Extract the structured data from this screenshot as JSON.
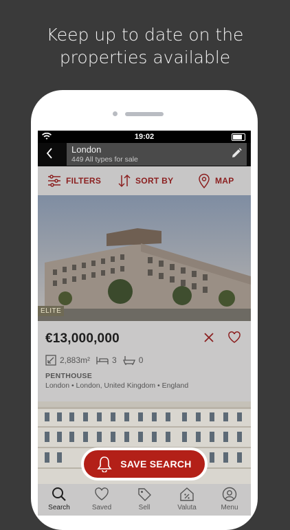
{
  "headline": {
    "line1": "Keep up to date on the",
    "line2": "properties available"
  },
  "status_bar": {
    "time": "19:02"
  },
  "search": {
    "location": "London",
    "summary": "449 All types for sale"
  },
  "toolbar": {
    "filters_label": "FILTERS",
    "sort_label": "SORT BY",
    "map_label": "MAP"
  },
  "listing": {
    "badge": "ELITE",
    "price": "€13,000,000",
    "area": "2,883m²",
    "bedrooms": "3",
    "bathrooms": "0",
    "property_type": "PENTHOUSE",
    "location": "London • London, United Kingdom • England"
  },
  "save_search": {
    "label": "SAVE SEARCH"
  },
  "tabs": [
    {
      "label": "Search",
      "icon": "search-icon"
    },
    {
      "label": "Saved",
      "icon": "heart-icon"
    },
    {
      "label": "Sell",
      "icon": "tag-icon"
    },
    {
      "label": "Valuta",
      "icon": "percent-house-icon"
    },
    {
      "label": "Menu",
      "icon": "user-icon"
    }
  ],
  "colors": {
    "accent": "#8b1f1f",
    "save_button": "#b32018",
    "background": "#3a3a3a"
  }
}
